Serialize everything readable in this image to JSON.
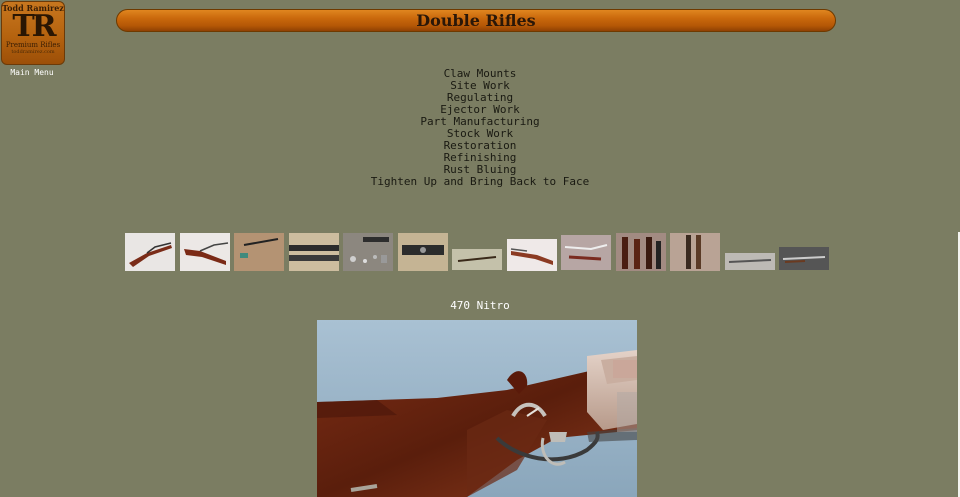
{
  "logo": {
    "top_text": "Todd Ramirez",
    "monogram": "TR",
    "bottom_text": "Premium Rifles",
    "url_text": "toddramirez.com"
  },
  "nav": {
    "main_menu_label": "Main Menu"
  },
  "header": {
    "title": "Double Rifles"
  },
  "services": [
    "Claw Mounts",
    "Site Work",
    "Regulating",
    "Ejector Work",
    "Part Manufacturing",
    "Stock Work",
    "Restoration",
    "Refinishing",
    "Rust Bluing",
    "Tighten Up and Bring Back to Face"
  ],
  "gallery": {
    "thumbnails": [
      "double-rifle-open-action",
      "double-rifle-open-action-alt",
      "rifle-on-workbench",
      "barrels-ribs",
      "disassembled-parts",
      "action-with-parts",
      "rifle-on-bench-small",
      "rifle-with-stock",
      "stock-sketch",
      "vertical-stocks",
      "barrels-vertical",
      "rifle-side-gray",
      "rifle-side-dark"
    ]
  },
  "featured": {
    "caption": "470 Nitro",
    "image": "470-nitro-double-rifle-action-photo"
  },
  "colors": {
    "background": "#7b7d62",
    "title_bar": "#c9680c",
    "title_text": "#2a1708"
  }
}
